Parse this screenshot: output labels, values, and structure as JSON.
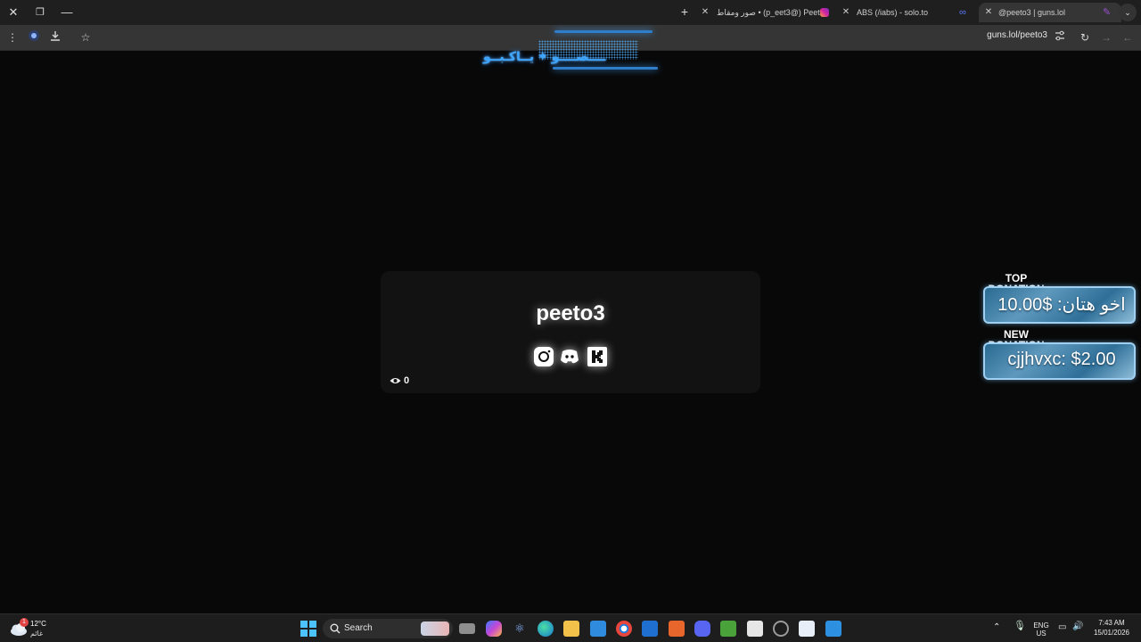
{
  "window_controls": {
    "close": "✕",
    "restore": "❐",
    "minimize": "—"
  },
  "tabs": [
    {
      "title": "صور ومقاط • (p_eet3@) Peeto3",
      "favicon_color": "#d6249f"
    },
    {
      "title": "ABS (/iabs) - solo.to",
      "favicon_color": "#3b5bdb"
    },
    {
      "title": "@peeto3 | guns.lol",
      "favicon_color": "#9a4fd1",
      "active": true
    }
  ],
  "address_bar": {
    "url": "guns.lol/peeto3"
  },
  "page": {
    "glitch_title": "ــــصــــو ✦ يــاكـبــو",
    "profile": {
      "username": "peeto3",
      "views": "0"
    },
    "socials": [
      {
        "icon": "instagram-icon"
      },
      {
        "icon": "discord-icon"
      },
      {
        "icon": "kick-icon"
      }
    ],
    "donations": {
      "top": {
        "label_line1": "TOP",
        "label_line2": "DONATION",
        "amount": "اخو هتان: $10.00"
      },
      "new": {
        "label_line1": "NEW",
        "label_line2": "DONATION",
        "amount": "cjjhvxc: $2.00"
      }
    }
  },
  "taskbar": {
    "weather": {
      "temp": "12°C",
      "condition": "غائم",
      "badge": "1"
    },
    "search_label": "Search",
    "language": {
      "line1": "ENG",
      "line2": "US"
    },
    "clock": {
      "time": "7:43 AM",
      "date": "15/01/2026"
    }
  }
}
